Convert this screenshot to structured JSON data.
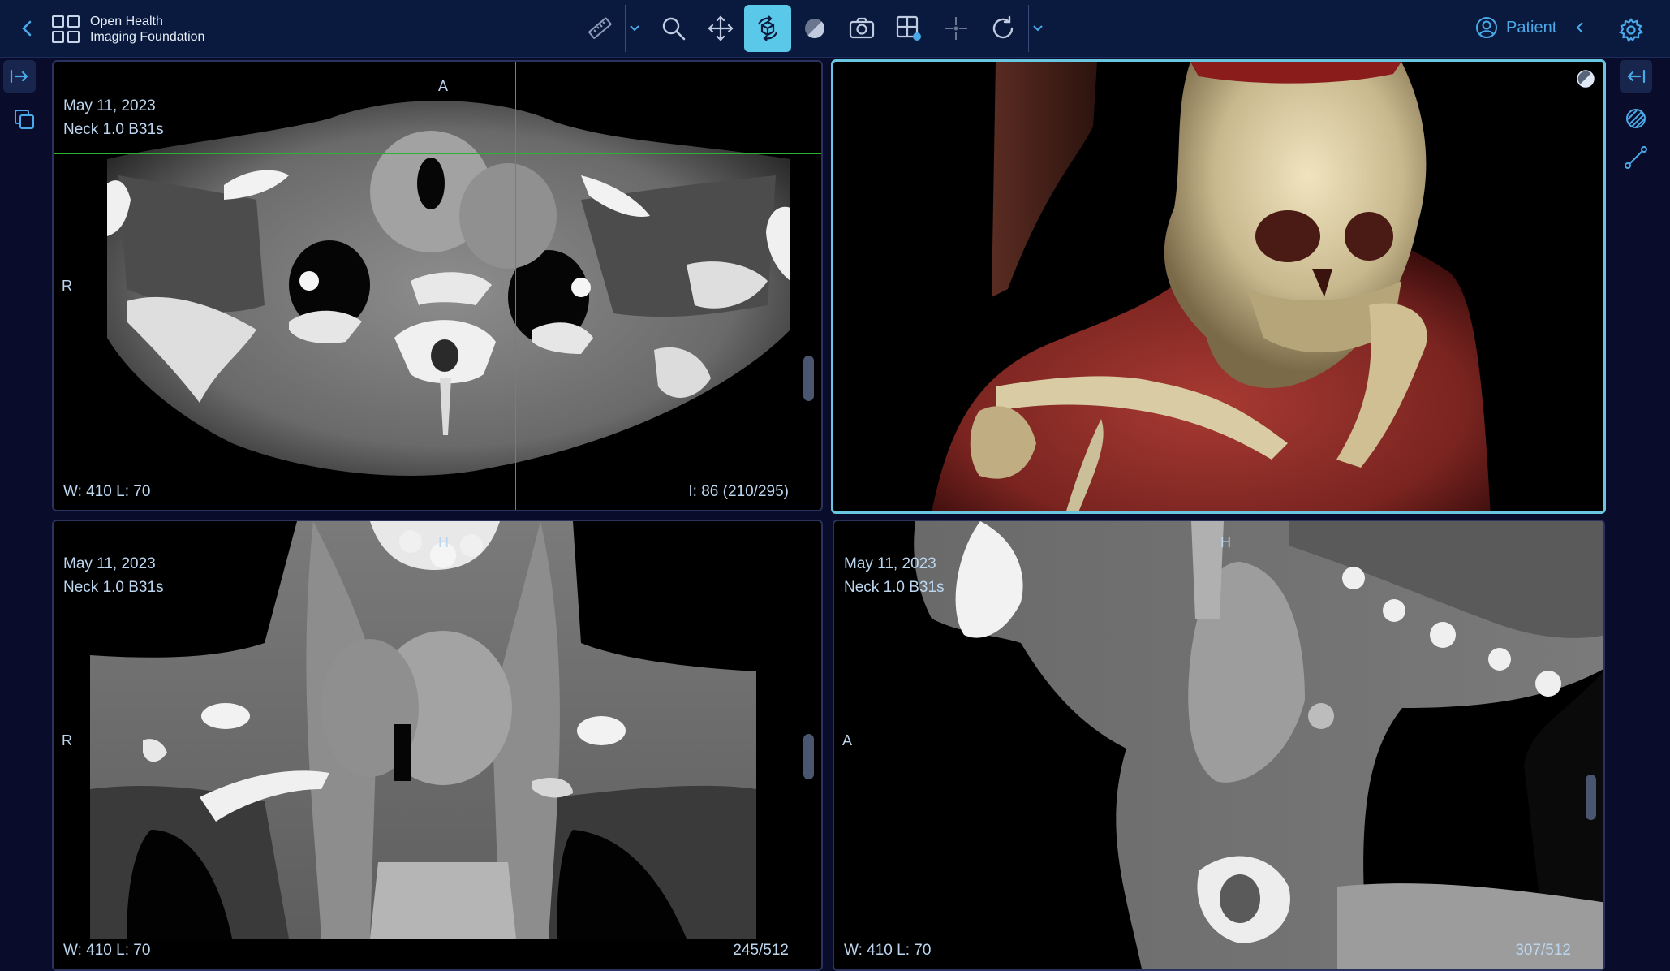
{
  "app": {
    "title_line1": "Open Health",
    "title_line2": "Imaging Foundation"
  },
  "toolbar": {
    "tools": [
      "ruler-icon",
      "zoom-icon",
      "pan-icon",
      "rotate-3d-icon",
      "contrast-icon",
      "camera-icon",
      "layout-icon",
      "crosshairs-icon",
      "reset-icon"
    ],
    "active_tool": "rotate-3d-icon",
    "accent_color": "#5ac8e8"
  },
  "patient": {
    "label": "Patient"
  },
  "viewports": {
    "axial": {
      "date": "May 11, 2023",
      "series": "Neck 1.0 B31s",
      "orient_top": "A",
      "orient_left": "R",
      "window": "W: 410  L: 70",
      "index": "I: 86 (210/295)"
    },
    "volume3d": {
      "description": "3D volume render"
    },
    "coronal": {
      "date": "May 11, 2023",
      "series": "Neck 1.0 B31s",
      "orient_top": "H",
      "orient_left": "R",
      "window": "W: 410  L: 70",
      "index": "245/512"
    },
    "sagittal": {
      "date": "May 11, 2023",
      "series": "Neck 1.0 B31s",
      "orient_top": "H",
      "orient_left": "A",
      "window": "W: 410  L: 70",
      "index": "307/512"
    }
  },
  "colors": {
    "crosshair": "#2fb02f",
    "active_border": "#68c6e0",
    "topbar": "#0a1a3e"
  }
}
